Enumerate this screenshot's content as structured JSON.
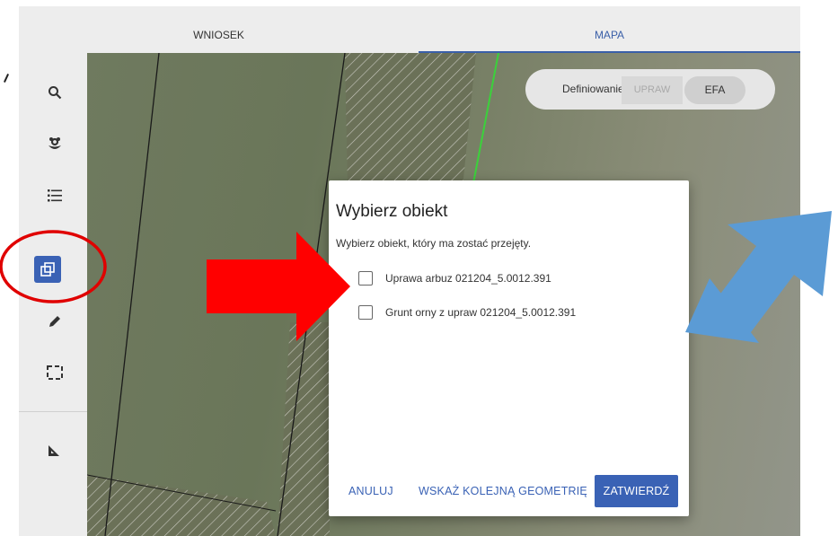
{
  "tabs": {
    "wniosek": "WNIOSEK",
    "mapa": "MAPA"
  },
  "toolbar": {
    "items": [
      "search-icon",
      "plant-icon",
      "list-icon",
      "copy-geometry-icon",
      "pencil-icon",
      "select-area-icon",
      "measure-icon"
    ],
    "active": "copy-geometry-icon",
    "accent": "#3a62b5"
  },
  "map_mode": {
    "label": "Definiowanie",
    "upraw": "UPRAW",
    "efa": "EFA"
  },
  "dialog": {
    "title": "Wybierz obiekt",
    "description": "Wybierz obiekt, który ma zostać przejęty.",
    "options": [
      {
        "label": "Uprawa arbuz 021204_5.0012.391",
        "checked": false
      },
      {
        "label": "Grunt orny z upraw 021204_5.0012.391",
        "checked": false
      }
    ],
    "buttons": {
      "cancel": "ANULUJ",
      "next_geometry": "WSKAŻ KOLEJNĄ GEOMETRIĘ",
      "confirm": "ZATWIERDŹ"
    }
  },
  "annotation_colors": {
    "circle": "#e00000",
    "red_arrow": "#ff0000",
    "blue_arrow": "#5b9bd5"
  }
}
